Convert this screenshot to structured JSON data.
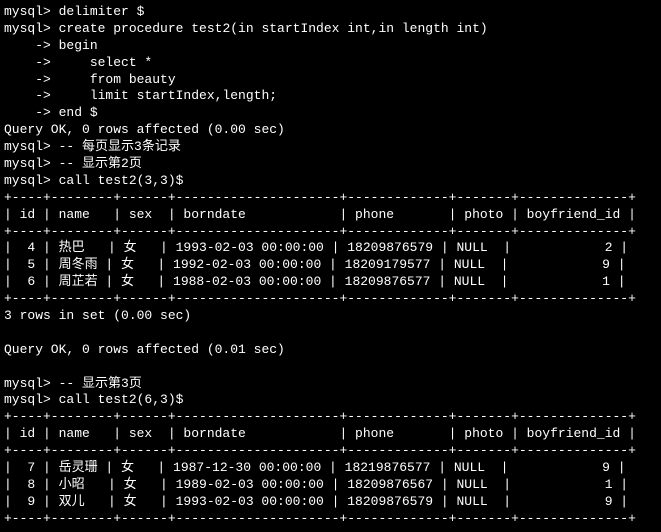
{
  "prompt": "mysql>",
  "cont": "    ->",
  "cmd_delimiter": " delimiter $",
  "cmd_create": " create procedure test2(in startIndex int,in length int)",
  "cmd_begin": " begin",
  "cmd_select": "     select *",
  "cmd_from": "     from beauty",
  "cmd_limit": "     limit startIndex,length;",
  "cmd_end": " end $",
  "query_ok_000": "Query OK, 0 rows affected (0.00 sec)",
  "comment_page_3rec": " -- 每页显示3条记录",
  "comment_show_p2": " -- 显示第2页",
  "call_33": " call test2(3,3)$",
  "header_row": "| id | name   | sex  | borndate            | phone       | photo | boyfriend_id |",
  "border": "+----+--------+------+---------------------+-------------+-------+--------------+",
  "page2": [
    "|  4 | 热巴   | 女   | 1993-02-03 00:00:00 | 18209876579 | NULL  |            2 |",
    "|  5 | 周冬雨 | 女   | 1992-02-03 00:00:00 | 18209179577 | NULL  |            9 |",
    "|  6 | 周芷若 | 女   | 1988-02-03 00:00:00 | 18209876577 | NULL  |            1 |"
  ],
  "rows_in_set": "3 rows in set (0.00 sec)",
  "query_ok_001": "Query OK, 0 rows affected (0.01 sec)",
  "comment_show_p3": " -- 显示第3页",
  "call_63": " call test2(6,3)$",
  "page3": [
    "|  7 | 岳灵珊 | 女   | 1987-12-30 00:00:00 | 18219876577 | NULL  |            9 |",
    "|  8 | 小昭   | 女   | 1989-02-03 00:00:00 | 18209876567 | NULL  |            1 |",
    "|  9 | 双儿   | 女   | 1993-02-03 00:00:00 | 18209876579 | NULL  |            9 |"
  ]
}
